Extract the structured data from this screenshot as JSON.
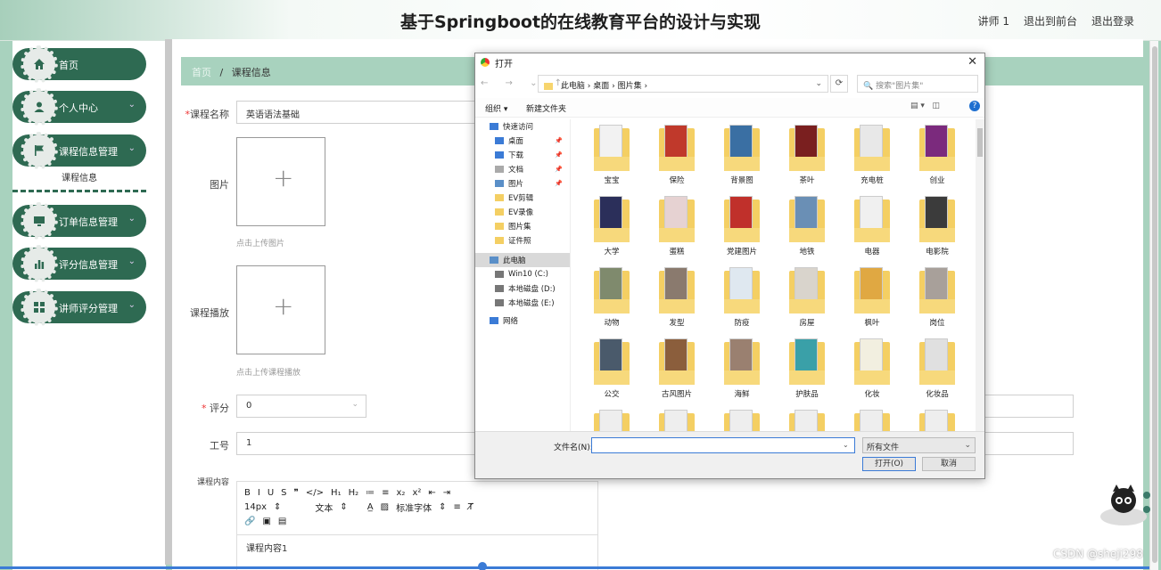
{
  "header": {
    "title": "基于Springboot的在线教育平台的设计与实现",
    "role": "讲师 1",
    "exit_front": "退出到前台",
    "logout": "退出登录"
  },
  "sidebar": {
    "items": [
      {
        "label": "首页",
        "icon": "home-icon"
      },
      {
        "label": "个人中心",
        "icon": "user-icon",
        "arrow": "⌄"
      },
      {
        "label": "课程信息管理",
        "icon": "flag-icon",
        "arrow": "⌄"
      },
      {
        "label": "订单信息管理",
        "icon": "monitor-icon",
        "arrow": "⌄"
      },
      {
        "label": "评分信息管理",
        "icon": "chart-icon",
        "arrow": "⌄"
      },
      {
        "label": "讲师评分管理",
        "icon": "grid-icon",
        "arrow": "⌄"
      }
    ],
    "submenu_label": "课程信息"
  },
  "breadcrumb": {
    "home": "首页",
    "sep": "/",
    "current": "课程信息"
  },
  "form": {
    "course_name_label": "课程名称",
    "course_name_value": "英语语法基础",
    "image_label": "图片",
    "image_hint": "点击上传图片",
    "video_label": "课程播放",
    "video_hint": "点击上传课程播放",
    "score_label": "评分",
    "score_value": "0",
    "teacher_no_label": "工号",
    "teacher_no_value": "1",
    "content_label": "课程内容",
    "required_mark": "*",
    "plus": "+"
  },
  "editor": {
    "row1": [
      "B",
      "I",
      "U",
      "S",
      "❞",
      "</>",
      "H₁",
      "H₂",
      "≔",
      "≡",
      "x₂",
      "x²",
      "⇤",
      "⇥"
    ],
    "font_size": "14px",
    "text_style": "文本",
    "font_family": "标准字体",
    "content": "课程内容1"
  },
  "dialog": {
    "title": "打开",
    "close": "✕",
    "path": [
      "此电脑",
      "桌面",
      "图片集"
    ],
    "search_placeholder": "搜索\"图片集\"",
    "organize": "组织 ▾",
    "new_folder": "新建文件夹",
    "tree": [
      {
        "label": "快速访问",
        "icon": "star-icon"
      },
      {
        "label": "桌面",
        "icon": "desktop-icon",
        "pin": true
      },
      {
        "label": "下载",
        "icon": "download-icon",
        "pin": true
      },
      {
        "label": "文档",
        "icon": "document-icon",
        "pin": true
      },
      {
        "label": "图片",
        "icon": "picture-icon",
        "pin": true
      },
      {
        "label": "EV剪辑",
        "icon": "folder-icon"
      },
      {
        "label": "EV录像",
        "icon": "folder-icon"
      },
      {
        "label": "图片集",
        "icon": "folder-icon"
      },
      {
        "label": "证件照",
        "icon": "folder-icon"
      },
      {
        "label": "此电脑",
        "icon": "computer-icon",
        "selected": true
      },
      {
        "label": "Win10 (C:)",
        "icon": "drive-icon"
      },
      {
        "label": "本地磁盘 (D:)",
        "icon": "drive-icon"
      },
      {
        "label": "本地磁盘 (E:)",
        "icon": "drive-icon"
      },
      {
        "label": "网络",
        "icon": "network-icon"
      }
    ],
    "folders": [
      "宝宝",
      "保险",
      "背景图",
      "茶叶",
      "充电桩",
      "创业",
      "大学",
      "蛋糕",
      "党建图片",
      "地铁",
      "电器",
      "电影院",
      "动物",
      "发型",
      "防疫",
      "房屋",
      "枫叶",
      "岗位",
      "公交",
      "古风图片",
      "海鲜",
      "护肤品",
      "化妆",
      "化妆品",
      "",
      "",
      "",
      "",
      "",
      ""
    ],
    "folder_colors": [
      "#f2f2f2",
      "#c0392b",
      "#3a6fa3",
      "#7a1f1f",
      "#e8e8e8",
      "#7b2a7d",
      "#2b2f5a",
      "#e6d2d2",
      "#c0302b",
      "#6a8fb5",
      "#f0f0f0",
      "#3b3b3b",
      "#7f8a6d",
      "#8a7a6e",
      "#dfe8f0",
      "#d9d4cc",
      "#e0a842",
      "#a8a09a",
      "#4a5a6b",
      "#8b5e3c",
      "#9a8070",
      "#3aa0a8",
      "#f2efe0",
      "#e0e0e0",
      "#eee",
      "#eee",
      "#eee",
      "#eee",
      "#eee",
      "#eee"
    ],
    "filename_label": "文件名(N):",
    "filename_value": "",
    "filetype": "所有文件",
    "open_btn": "打开(O)",
    "cancel_btn": "取消"
  },
  "watermark": "CSDN @sheji298"
}
